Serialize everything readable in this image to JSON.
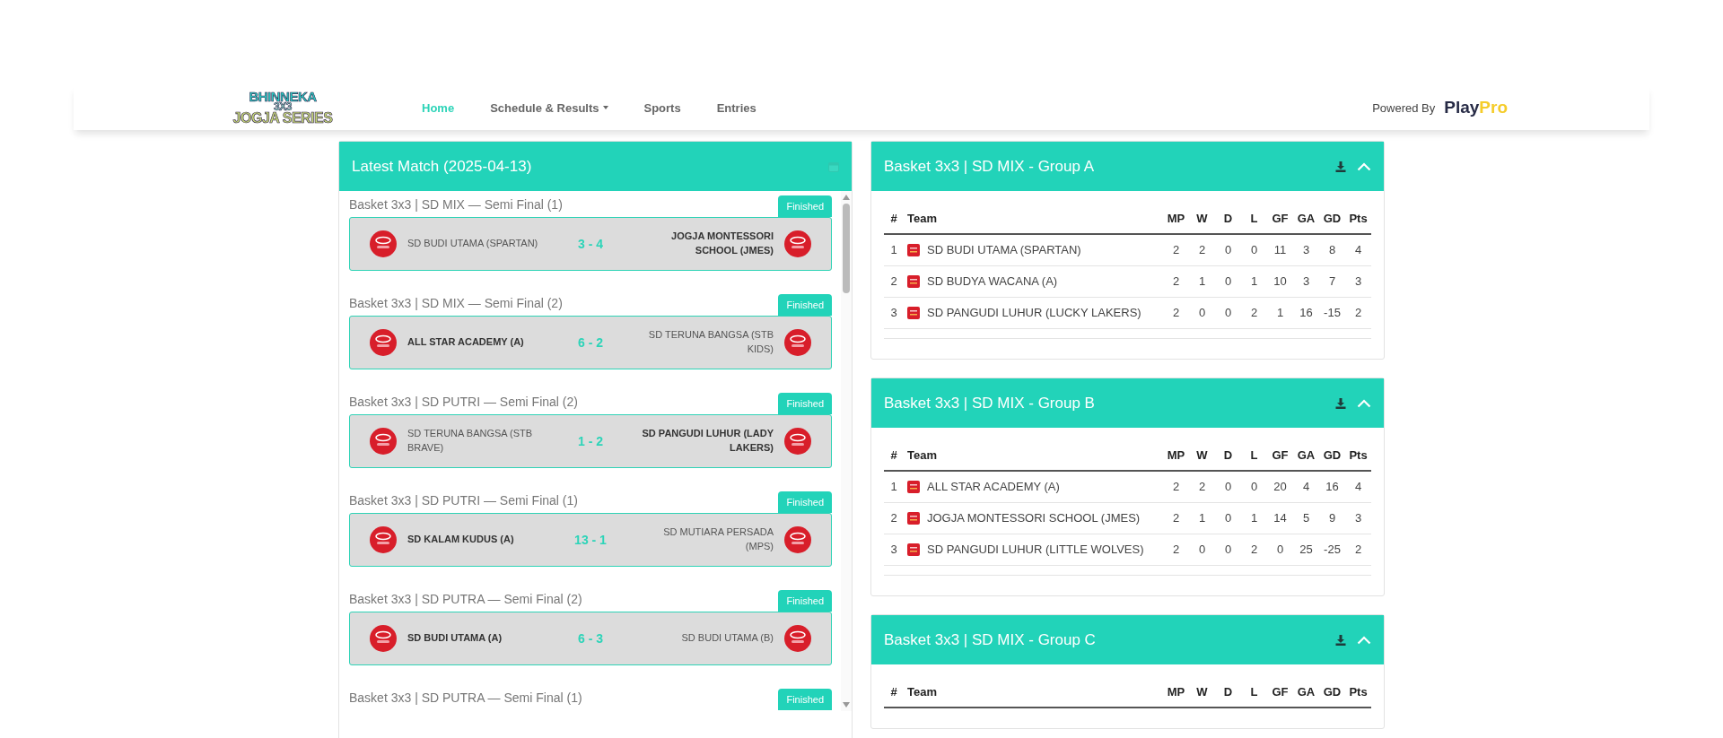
{
  "header": {
    "logo_lines": [
      "BHINNEKA",
      "3X3",
      "JOGJA SERIES"
    ],
    "nav": [
      {
        "label": "Home",
        "selected": true,
        "dropdown": false
      },
      {
        "label": "Schedule & Results",
        "selected": false,
        "dropdown": true
      },
      {
        "label": "Sports",
        "selected": false,
        "dropdown": false
      },
      {
        "label": "Entries",
        "selected": false,
        "dropdown": false
      }
    ],
    "powered_by": "Powered By",
    "brand": [
      "Play",
      "Pro"
    ]
  },
  "latest": {
    "title": "Latest Match (2025-04-13)",
    "matches": [
      {
        "category": "Basket 3x3 | SD MIX — Semi Final (1)",
        "status": "Finished",
        "home": {
          "name": "SD BUDI UTAMA (SPARTAN)",
          "winner": false
        },
        "score": "3 - 4",
        "away": {
          "name": "JOGJA MONTESSORI SCHOOL (JMES)",
          "winner": true
        }
      },
      {
        "category": "Basket 3x3 | SD MIX — Semi Final (2)",
        "status": "Finished",
        "home": {
          "name": "ALL STAR ACADEMY (A)",
          "winner": true
        },
        "score": "6 - 2",
        "away": {
          "name": "SD TERUNA BANGSA (STB KIDS)",
          "winner": false
        }
      },
      {
        "category": "Basket 3x3 | SD PUTRI — Semi Final (2)",
        "status": "Finished",
        "home": {
          "name": "SD TERUNA BANGSA (STB BRAVE)",
          "winner": false
        },
        "score": "1 - 2",
        "away": {
          "name": "SD PANGUDI LUHUR (LADY LAKERS)",
          "winner": true
        }
      },
      {
        "category": "Basket 3x3 | SD PUTRI — Semi Final (1)",
        "status": "Finished",
        "home": {
          "name": "SD KALAM KUDUS (A)",
          "winner": true
        },
        "score": "13 - 1",
        "away": {
          "name": "SD MUTIARA PERSADA (MPS)",
          "winner": false
        }
      },
      {
        "category": "Basket 3x3 | SD PUTRA — Semi Final (2)",
        "status": "Finished",
        "home": {
          "name": "SD BUDI UTAMA (A)",
          "winner": true
        },
        "score": "6 - 3",
        "away": {
          "name": "SD BUDI UTAMA (B)",
          "winner": false
        }
      },
      {
        "category": "Basket 3x3 | SD PUTRA — Semi Final (1)",
        "status": "Finished"
      }
    ]
  },
  "groups": [
    {
      "title": "Basket 3x3 | SD MIX - Group A",
      "expanded": true,
      "columns": [
        "#",
        "Team",
        "MP",
        "W",
        "D",
        "L",
        "GF",
        "GA",
        "GD",
        "Pts"
      ],
      "rows": [
        {
          "rank": "1",
          "team": "SD BUDI UTAMA (SPARTAN)",
          "stats": [
            "2",
            "2",
            "0",
            "0",
            "11",
            "3",
            "8",
            "4"
          ]
        },
        {
          "rank": "2",
          "team": "SD BUDYA WACANA (A)",
          "stats": [
            "2",
            "1",
            "0",
            "1",
            "10",
            "3",
            "7",
            "3"
          ]
        },
        {
          "rank": "3",
          "team": "SD PANGUDI LUHUR (LUCKY LAKERS)",
          "stats": [
            "2",
            "0",
            "0",
            "2",
            "1",
            "16",
            "-15",
            "2"
          ]
        }
      ]
    },
    {
      "title": "Basket 3x3 | SD MIX - Group B",
      "expanded": true,
      "columns": [
        "#",
        "Team",
        "MP",
        "W",
        "D",
        "L",
        "GF",
        "GA",
        "GD",
        "Pts"
      ],
      "rows": [
        {
          "rank": "1",
          "team": "ALL STAR ACADEMY (A)",
          "stats": [
            "2",
            "2",
            "0",
            "0",
            "20",
            "4",
            "16",
            "4"
          ]
        },
        {
          "rank": "2",
          "team": "JOGJA MONTESSORI SCHOOL (JMES)",
          "stats": [
            "2",
            "1",
            "0",
            "1",
            "14",
            "5",
            "9",
            "3"
          ]
        },
        {
          "rank": "3",
          "team": "SD PANGUDI LUHUR (LITTLE WOLVES)",
          "stats": [
            "2",
            "0",
            "0",
            "2",
            "0",
            "25",
            "-25",
            "2"
          ]
        }
      ]
    },
    {
      "title": "Basket 3x3 | SD MIX - Group C",
      "expanded": true,
      "columns": [
        "#",
        "Team",
        "MP",
        "W",
        "D",
        "L",
        "GF",
        "GA",
        "GD",
        "Pts"
      ]
    }
  ]
}
